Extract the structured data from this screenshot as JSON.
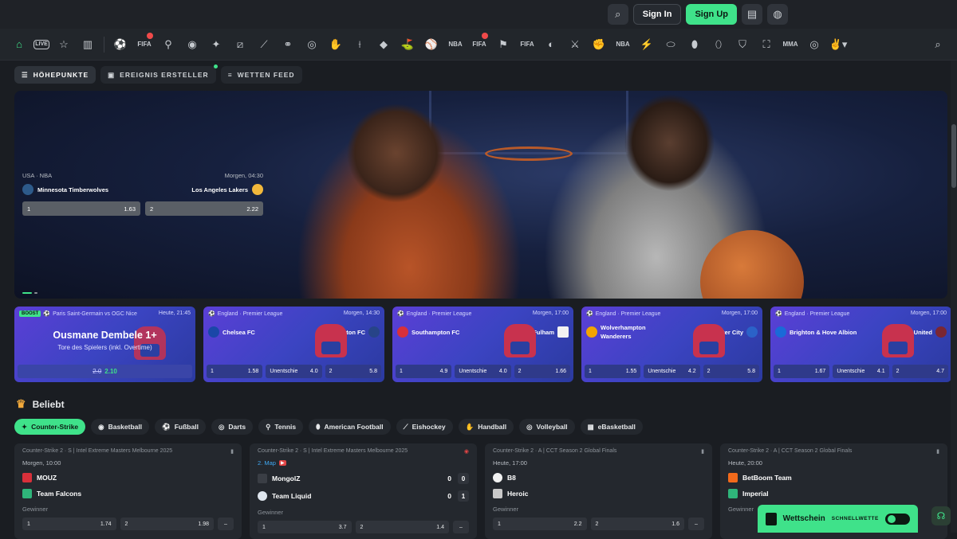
{
  "header": {
    "signin_label": "Sign In",
    "signup_label": "Sign Up"
  },
  "sportnav": {
    "live_label": "LIVE",
    "icons": [
      "home-icon",
      "live-icon",
      "star-icon",
      "betslip-icon",
      "soccer-icon",
      "fifa-icon",
      "tennis-icon",
      "basketball-icon",
      "counter-strike-icon",
      "dota-icon",
      "hockey-icon",
      "badminton-icon",
      "volleyball-icon",
      "handball-icon",
      "cricket-icon",
      "table-tennis-icon",
      "golf-icon",
      "baseball-icon",
      "nba2k-icon",
      "efifa-icon",
      "penalty-fifa-icon",
      "efootball-icon",
      "wrestling-icon",
      "boxing-icon",
      "nba2k-2-icon",
      "esports-icon",
      "rugby-icon",
      "american-football-icon",
      "aussie-rules-icon",
      "motorsport-icon",
      "league-icon",
      "mma-icon",
      "darts-icon",
      "more-icon"
    ],
    "labels": {
      "fifa": "FIFA",
      "nba": "NBA",
      "mma": "MMA"
    }
  },
  "filters": [
    {
      "label": "HÖHEPUNKTE"
    },
    {
      "label": "EREIGNIS ERSTELLER"
    },
    {
      "label": "WETTEN FEED"
    }
  ],
  "hero": {
    "league": "USA · NBA",
    "time": "Morgen, 04:30",
    "home": "Minnesota Timberwolves",
    "away": "Los Angeles Lakers",
    "odds": [
      {
        "label": "1",
        "value": "1.63"
      },
      {
        "label": "2",
        "value": "2.22"
      }
    ]
  },
  "promo_cards": [
    {
      "boost_label": "BOOST",
      "league": "Paris Saint-Germain vs OGC Nice",
      "time": "Heute, 21:45",
      "title": "Ousmane Dembele 1+",
      "subtitle": "Tore des Spielers (inkl. Overtime)",
      "old_odd": "2.0",
      "new_odd": "2.10"
    },
    {
      "league": "England · Premier League",
      "time": "Morgen, 14:30",
      "home": "Chelsea FC",
      "away": "Everton FC",
      "odds": [
        [
          "1",
          "1.58"
        ],
        [
          "Unentschie",
          "4.0"
        ],
        [
          "2",
          "5.8"
        ]
      ]
    },
    {
      "league": "England · Premier League",
      "time": "Morgen, 17:00",
      "home": "Southampton FC",
      "away": "FC Fulham",
      "odds": [
        [
          "1",
          "4.9"
        ],
        [
          "Unentschie",
          "4.0"
        ],
        [
          "2",
          "1.66"
        ]
      ]
    },
    {
      "league": "England · Premier League",
      "time": "Morgen, 17:00",
      "home": "Wolverhampton Wanderers",
      "away": "Leicester City",
      "odds": [
        [
          "1",
          "1.55"
        ],
        [
          "Unentschie",
          "4.2"
        ],
        [
          "2",
          "5.8"
        ]
      ]
    },
    {
      "league": "England · Premier League",
      "time": "Morgen, 17:00",
      "home": "Brighton & Hove Albion",
      "away": "West Ham United",
      "odds": [
        [
          "1",
          "1.67"
        ],
        [
          "Unentschie",
          "4.1"
        ],
        [
          "2",
          "4.7"
        ]
      ]
    }
  ],
  "beliebt_title": "Beliebt",
  "sport_tabs": [
    "Counter-Strike",
    "Basketball",
    "Fußball",
    "Darts",
    "Tennis",
    "American Football",
    "Eishockey",
    "Handball",
    "Volleyball",
    "eBasketball"
  ],
  "matches": [
    {
      "league": "Counter-Strike 2 · S | Intel Extreme Masters Melbourne 2025",
      "time": "Morgen, 10:00",
      "home": "MOUZ",
      "away": "Team Falcons",
      "market": "Gewinner",
      "odds": [
        "1.74",
        "1.98"
      ]
    },
    {
      "league": "Counter-Strike 2 · S | Intel Extreme Masters Melbourne 2025",
      "time": "2. Map",
      "home": "MongolZ",
      "away": "Team Liquid",
      "home_scores": [
        "0",
        "0"
      ],
      "away_scores": [
        "0",
        "1"
      ],
      "market": "Gewinner",
      "odds": [
        "3.7",
        "1.4"
      ]
    },
    {
      "league": "Counter-Strike 2 · A | CCT Season 2 Global Finals",
      "time": "Heute, 17:00",
      "home": "B8",
      "away": "Heroic",
      "market": "Gewinner",
      "odds": [
        "2.2",
        "1.6"
      ]
    },
    {
      "league": "Counter-Strike 2 · A | CCT Season 2 Global Finals",
      "time": "Heute, 20:00",
      "home": "BetBoom Team",
      "away": "Imperial",
      "market": "Gewinner",
      "odds": [
        "",
        ""
      ]
    }
  ],
  "betslip": {
    "label": "Wettschein",
    "quick_label": "SCHNELLWETTE"
  }
}
